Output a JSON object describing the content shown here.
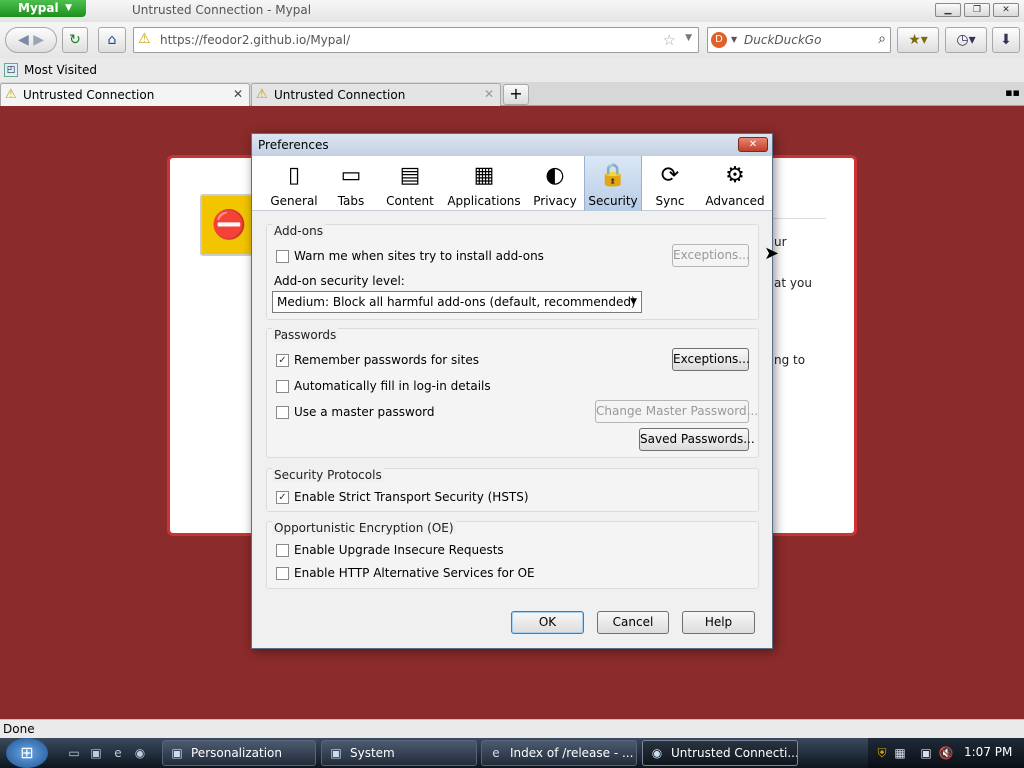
{
  "app": {
    "menu_button": "Mypal",
    "window_title": "Untrusted Connection - Mypal"
  },
  "window_controls": {
    "minimize": "▁",
    "maximize": "❐",
    "close": "✕"
  },
  "navbar": {
    "back": "◀",
    "forward": "▶",
    "reload": "↻",
    "home": "⌂",
    "url": "https://feodor2.github.io/Mypal/",
    "search_placeholder": "DuckDuckGo"
  },
  "bookmarks": {
    "items": [
      {
        "label": "Most Visited"
      }
    ]
  },
  "tabs": [
    {
      "label": "Untrusted Connection",
      "active": true
    },
    {
      "label": "Untrusted Connection",
      "active": false
    }
  ],
  "new_tab": "+",
  "error_page": {
    "fragments": [
      "ur",
      "at you",
      "ng to"
    ]
  },
  "preferences": {
    "title": "Preferences",
    "tabs": [
      {
        "label": "General",
        "icon": "general-icon",
        "glyph": "▯"
      },
      {
        "label": "Tabs",
        "icon": "tabs-icon",
        "glyph": "▭"
      },
      {
        "label": "Content",
        "icon": "content-icon",
        "glyph": "▤"
      },
      {
        "label": "Applications",
        "icon": "applications-icon",
        "glyph": "▦"
      },
      {
        "label": "Privacy",
        "icon": "privacy-mask-icon",
        "glyph": "◐"
      },
      {
        "label": "Security",
        "icon": "lock-icon",
        "glyph": "🔒",
        "selected": true
      },
      {
        "label": "Sync",
        "icon": "sync-icon",
        "glyph": "⟳"
      },
      {
        "label": "Advanced",
        "icon": "gear-icon",
        "glyph": "⚙"
      }
    ],
    "addons": {
      "title": "Add-ons",
      "warn_label": "Warn me when sites try to install add-ons",
      "warn_checked": false,
      "exceptions": "Exceptions...",
      "level_label": "Add-on security level:",
      "level_value": "Medium: Block all harmful add-ons (default, recommended)"
    },
    "passwords": {
      "title": "Passwords",
      "remember_label": "Remember passwords for sites",
      "remember_checked": true,
      "autofill_label": "Automatically fill in log-in details",
      "autofill_checked": false,
      "master_label": "Use a master password",
      "master_checked": false,
      "exceptions": "Exceptions...",
      "change_master": "Change Master Password...",
      "saved": "Saved Passwords..."
    },
    "protocols": {
      "title": "Security Protocols",
      "hsts_label": "Enable Strict Transport Security (HSTS)",
      "hsts_checked": true
    },
    "oe": {
      "title": "Opportunistic Encryption (OE)",
      "upgrade_label": "Enable Upgrade Insecure Requests",
      "upgrade_checked": false,
      "altsvc_label": "Enable HTTP Alternative Services for OE",
      "altsvc_checked": false
    },
    "buttons": {
      "ok": "OK",
      "cancel": "Cancel",
      "help": "Help"
    }
  },
  "status": {
    "text": "Done"
  },
  "taskbar": {
    "tasks": [
      {
        "label": "Personalization",
        "icon": "personalization-icon",
        "glyph": "▣"
      },
      {
        "label": "System",
        "icon": "system-icon",
        "glyph": "▣"
      },
      {
        "label": "Index of /release - ...",
        "icon": "browser-icon",
        "glyph": "e"
      },
      {
        "label": "Untrusted Connecti...",
        "icon": "mypal-icon",
        "glyph": "◉",
        "active": true
      }
    ],
    "clock": "1:07 PM"
  },
  "colors": {
    "error_bg": "#8b2b2b",
    "mypal_green": "#2fa52f",
    "dialog_border": "#5b6e8a"
  }
}
